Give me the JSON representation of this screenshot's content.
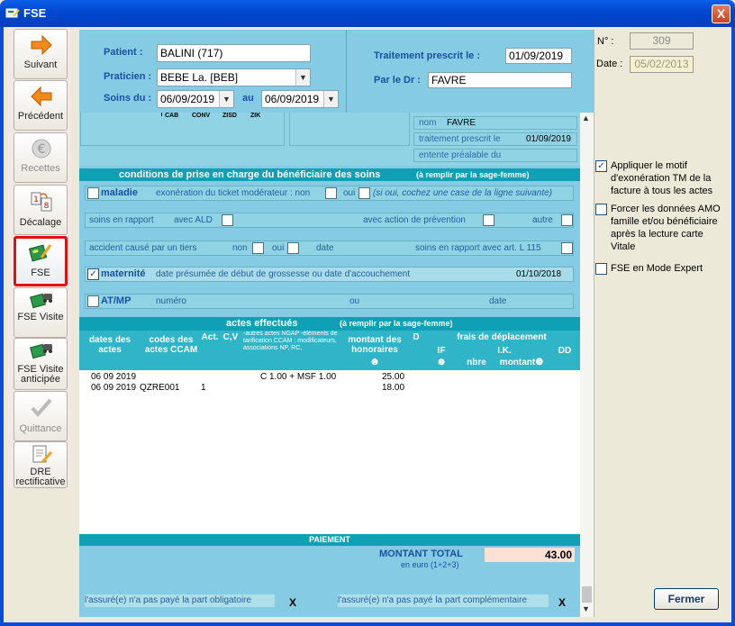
{
  "window": {
    "title": "FSE",
    "close_label": "X"
  },
  "sidebar": {
    "items": [
      {
        "label": "Suivant",
        "icon": "arrow-right-icon",
        "enabled": true
      },
      {
        "label": "Précédent",
        "icon": "arrow-left-icon",
        "enabled": true
      },
      {
        "label": "Recettes",
        "icon": "euro-coin-icon",
        "enabled": false
      },
      {
        "label": "Décalage",
        "icon": "calendar-icon",
        "enabled": true
      },
      {
        "label": "FSE",
        "icon": "card-pen-icon",
        "enabled": true,
        "selected": true
      },
      {
        "label": "FSE Visite",
        "icon": "card-car-icon",
        "enabled": true
      },
      {
        "label": "FSE Visite anticipée",
        "icon": "card-car-icon",
        "enabled": true
      },
      {
        "label": "Quittance",
        "icon": "check-receipt-icon",
        "enabled": false
      },
      {
        "label": "DRE rectificative",
        "icon": "document-pen-icon",
        "enabled": true
      }
    ]
  },
  "patient": {
    "label": "Patient :",
    "value": "BALINI (717)"
  },
  "praticien": {
    "label": "Praticien :",
    "value": "BEBE La. [BEB]"
  },
  "soins": {
    "label": "Soins du :",
    "from": "06/09/2019",
    "au_label": "au",
    "to": "06/09/2019"
  },
  "traitement": {
    "label": "Traitement prescrit le :",
    "value": "01/09/2019",
    "dr_label": "Par le Dr :",
    "dr_value": "FAVRE"
  },
  "partial_header": {
    "codes": [
      "CAB",
      "CONV",
      "ZISD",
      "ZIK"
    ],
    "nom_label": "nom",
    "nom_value": "FAVRE",
    "traitement_label": "traitement prescrit le",
    "traitement_value": "01/09/2019",
    "entente_label": "entente préalable du"
  },
  "conditions": {
    "title": "conditions de prise en charge du bénéficiaire des soins",
    "subtitle": "(à remplir par la sage-femme)",
    "maladie": {
      "label": "maladie",
      "exo": "exonération du ticket modérateur : non",
      "oui": "oui",
      "note": "(si oui, cochez une case de la ligne suivante)"
    },
    "soins": {
      "label": "soins en rapport",
      "ald": "avec ALD",
      "prevention": "avec action de prévention",
      "autre": "autre"
    },
    "accident": {
      "label": "accident causé par un tiers",
      "non": "non",
      "oui": "oui",
      "date": "date",
      "art": "soins en rapport avec art. L 115"
    },
    "maternite": {
      "label": "maternité",
      "text": "date présumée de début de grossesse ou date d'accouchement",
      "value": "01/10/2018",
      "checked": true
    },
    "atmp": {
      "label": "AT/MP",
      "numero": "numéro",
      "ou": "ou",
      "date": "date"
    }
  },
  "actes": {
    "title": "actes effectués",
    "subtitle": "(à remplir par la sage-femme)",
    "headers": {
      "dates": "dates des actes",
      "codes": "codes des actes CCAM",
      "act": "Act.",
      "cv": "C,V",
      "autres": "-autres actes NGAP -éléments de tarification CCAM : modificateurs, associations NP, RC,",
      "montant": "montant des honoraires",
      "montant_num": "❶",
      "d": "D",
      "frais": "frais de déplacement",
      "if": "IF",
      "if_num": "❷",
      "ik": "I.K.",
      "nbre": "nbre",
      "montant_ik": "montant❸",
      "dd": "DD"
    },
    "rows": [
      {
        "date": "06 09 2019",
        "code": "",
        "act": "",
        "autres": "C 1.00 +  MSF 1.00",
        "montant": "25.00"
      },
      {
        "date": "06 09 2019",
        "code": "QZRE001",
        "act": "1",
        "autres": "",
        "montant": "18.00"
      }
    ]
  },
  "paiement": {
    "title": "PAIEMENT",
    "total_label": "MONTANT TOTAL",
    "total_sub": "en euro (1+2+3)",
    "total_value": "43.00",
    "oblig": "l'assuré(e) n'a pas payé la part obligatoire",
    "oblig_mark": "X",
    "compl": "l'assuré(e) n'a pas payé la part complémentaire",
    "compl_mark": "X"
  },
  "right_panel": {
    "no_label": "N° :",
    "no_value": "309",
    "date_label": "Date :",
    "date_value": "05/02/2013",
    "options": [
      {
        "label": "Appliquer le motif d'exonération TM de la facture à tous les actes",
        "checked": true
      },
      {
        "label": "Forcer les données AMO famille et/ou bénéficiaire après la lecture carte Vitale",
        "checked": false
      },
      {
        "label": "FSE en Mode Expert",
        "checked": false
      }
    ],
    "close_button": "Fermer"
  },
  "colors": {
    "panel": "#86cbe4",
    "bar": "#0fa0b6",
    "label": "#1a50a0",
    "highlight": "#e01010"
  }
}
